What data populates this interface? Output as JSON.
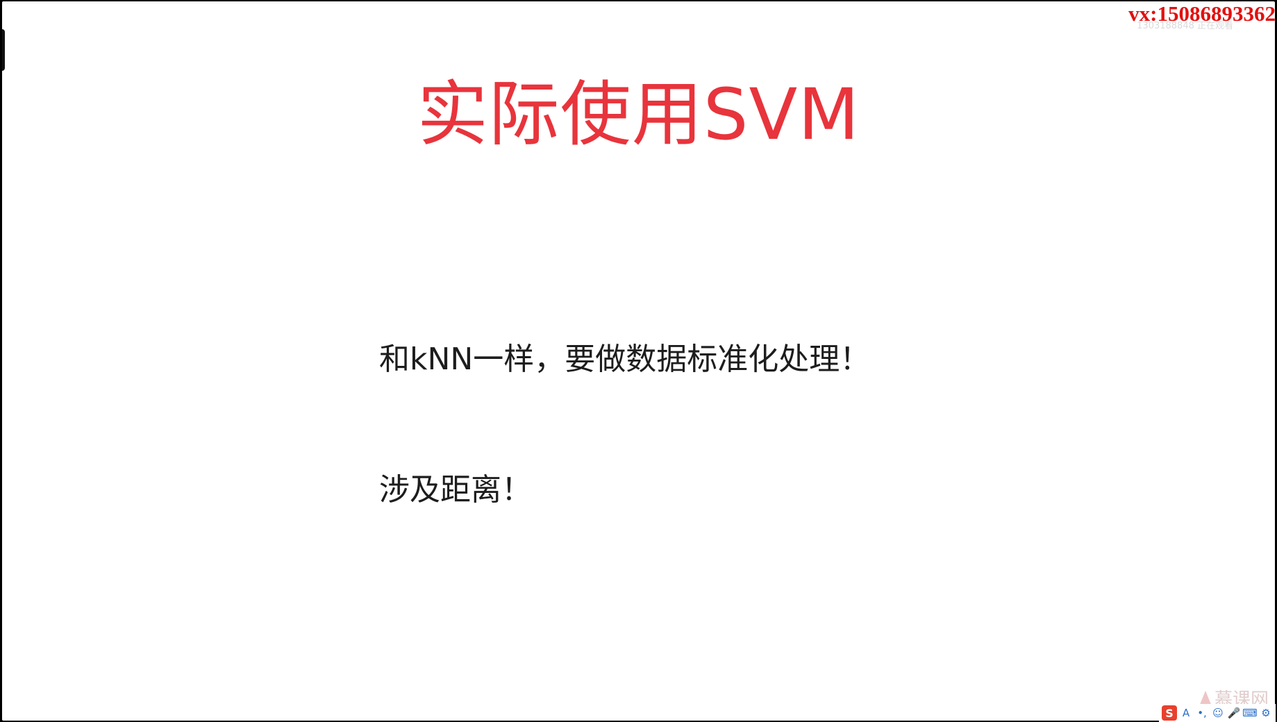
{
  "overlay": {
    "contact": "vx:15086893362",
    "viewer_faint": "1303188848 正在观看"
  },
  "slide": {
    "title": "实际使用SVM",
    "line1": "和kNN一样，要做数据标准化处理！",
    "line2": "涉及距离！"
  },
  "brand": {
    "logo_text": "慕课网"
  },
  "ime": {
    "logo": "S",
    "mode": "A",
    "punct": "•,",
    "emoji": "☺",
    "voice": "🎤",
    "keyboard": "⌨",
    "tools": "⚙"
  },
  "colors": {
    "title": "#e8343c",
    "contact": "#e21010",
    "body_text": "#1d1d1d",
    "background": "#ffffff"
  }
}
